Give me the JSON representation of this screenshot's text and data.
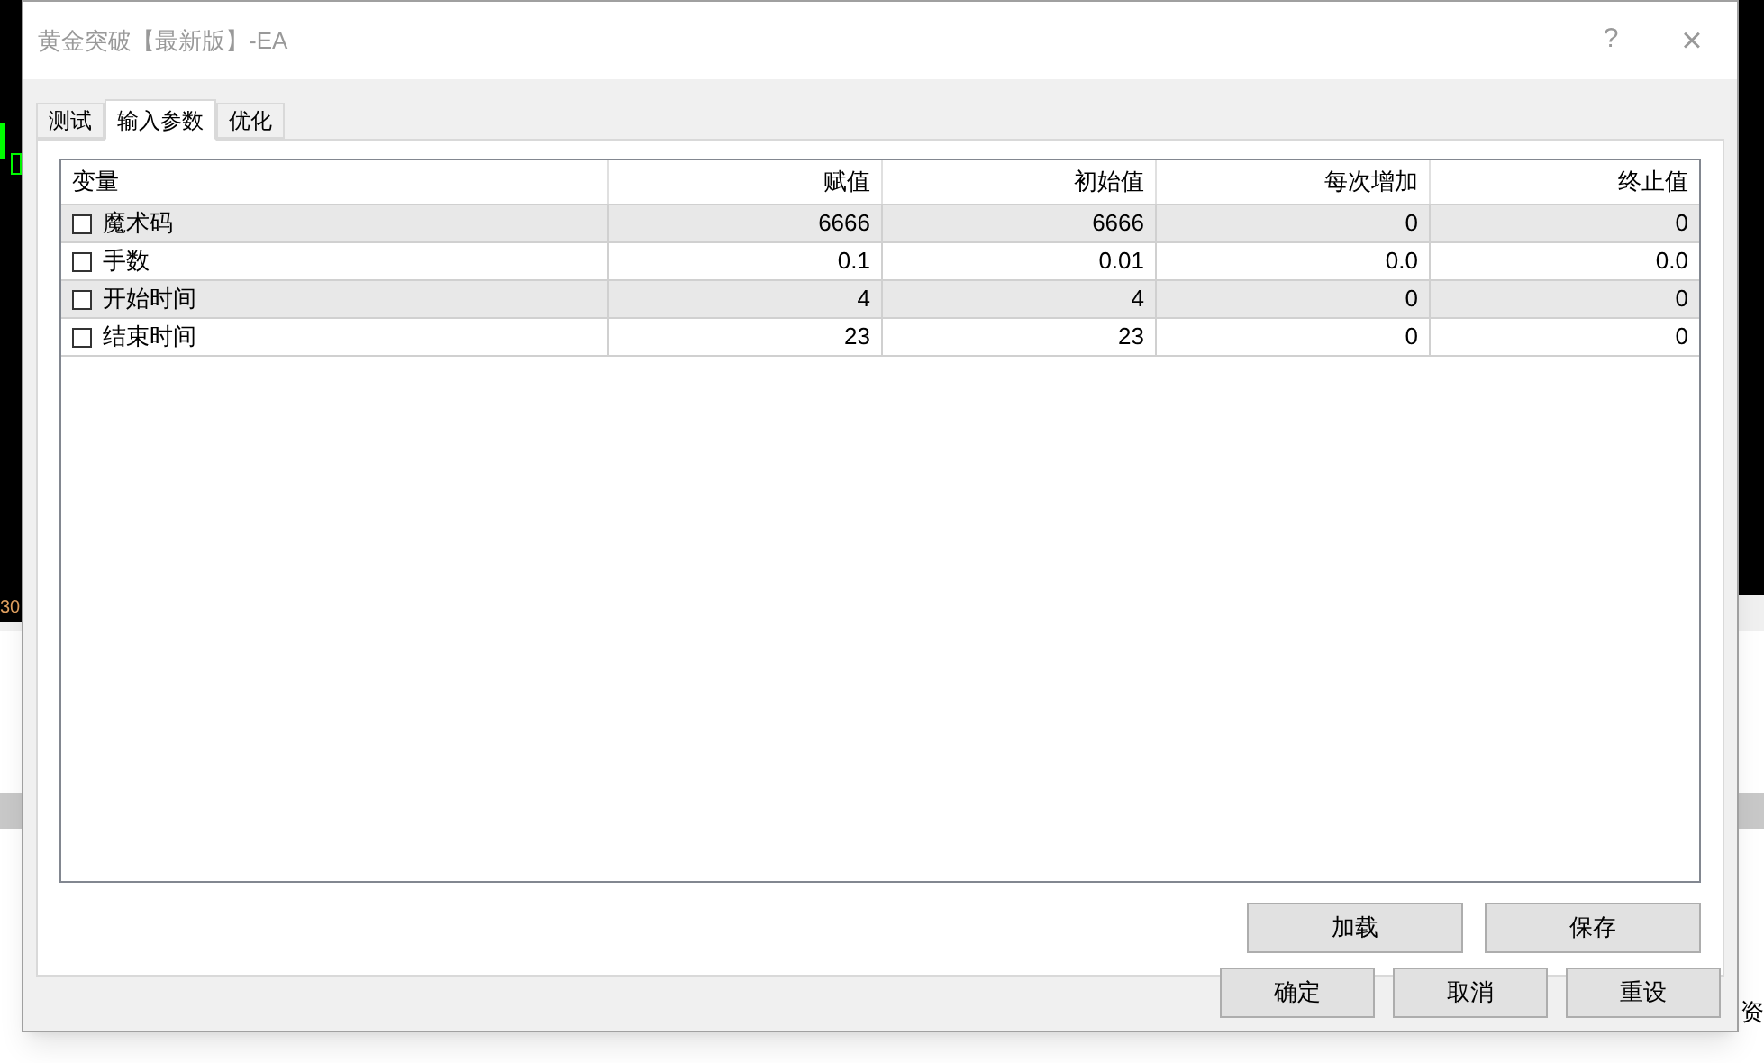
{
  "background": {
    "chart_label": "30",
    "right_text": "资"
  },
  "window": {
    "title": "黄金突破【最新版】-EA",
    "help": "?",
    "close": "×"
  },
  "tabs": [
    {
      "label": "测试",
      "selected": false
    },
    {
      "label": "输入参数",
      "selected": true
    },
    {
      "label": "优化",
      "selected": false
    }
  ],
  "table": {
    "columns": [
      "变量",
      "赋值",
      "初始值",
      "每次增加",
      "终止值"
    ],
    "rows": [
      {
        "checked": false,
        "cells": [
          "魔术码",
          "6666",
          "6666",
          "0",
          "0"
        ]
      },
      {
        "checked": false,
        "cells": [
          "手数",
          "0.1",
          "0.01",
          "0.0",
          "0.0"
        ]
      },
      {
        "checked": false,
        "cells": [
          "开始时间",
          "4",
          "4",
          "0",
          "0"
        ]
      },
      {
        "checked": false,
        "cells": [
          "结束时间",
          "23",
          "23",
          "0",
          "0"
        ]
      }
    ]
  },
  "panel_buttons": [
    "加载",
    "保存"
  ],
  "buttons": [
    "确定",
    "取消",
    "重设"
  ]
}
